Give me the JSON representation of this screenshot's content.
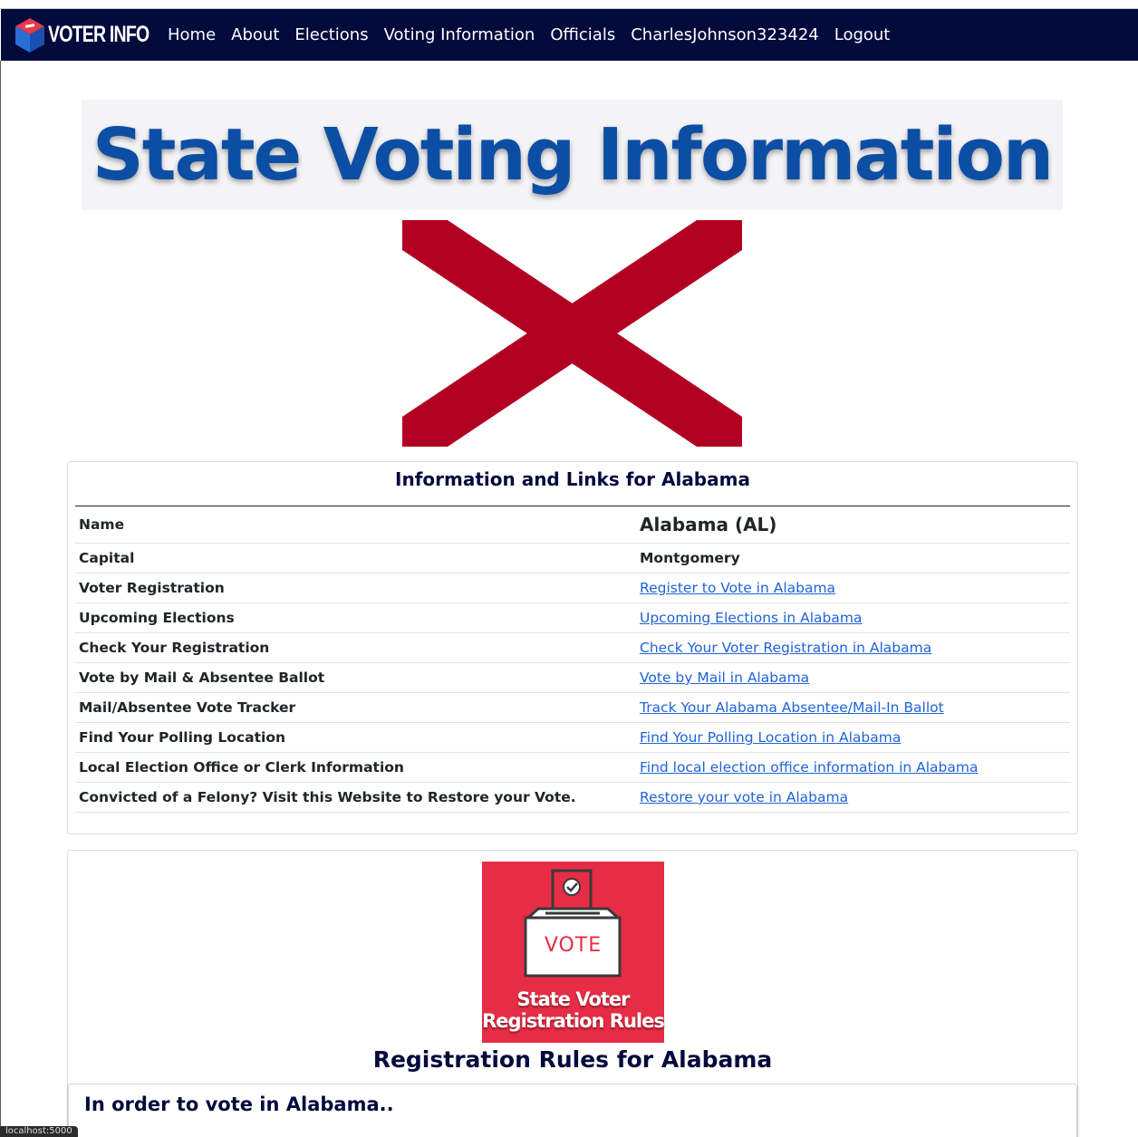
{
  "navbar": {
    "brand": "VOTER INFO",
    "links": [
      "Home",
      "About",
      "Elections",
      "Voting Information",
      "Officials",
      "CharlesJohnson323424",
      "Logout"
    ]
  },
  "banner": {
    "title": "State Voting Information"
  },
  "info_card": {
    "title": "Information and Links for Alabama",
    "rows": [
      {
        "label": "Name",
        "value": "Alabama (AL)"
      },
      {
        "label": "Capital",
        "value": "Montgomery"
      },
      {
        "label": "Voter Registration",
        "value": "Register to Vote in Alabama"
      },
      {
        "label": "Upcoming Elections",
        "value": "Upcoming Elections in Alabama"
      },
      {
        "label": "Check Your Registration",
        "value": "Check Your Voter Registration in Alabama"
      },
      {
        "label": "Vote by Mail & Absentee Ballot",
        "value": "Vote by Mail in Alabama"
      },
      {
        "label": "Mail/Absentee Vote Tracker",
        "value": "Track Your Alabama Absentee/Mail-In Ballot"
      },
      {
        "label": "Find Your Polling Location",
        "value": "Find Your Polling Location in Alabama"
      },
      {
        "label": "Local Election Office or Clerk Information",
        "value": "Find local election office information in Alabama"
      },
      {
        "label": "Convicted of a Felony? Visit this Website to Restore your Vote.",
        "value": "Restore your vote in Alabama"
      }
    ]
  },
  "rules_card": {
    "image": {
      "box_label": "VOTE",
      "caption_line1": "State Voter",
      "caption_line2": "Registration Rules"
    },
    "title": "Registration Rules for Alabama",
    "inner_title": "In order to vote in Alabama.."
  },
  "status_bar": "localhost:5000",
  "colors": {
    "navbar": "#030a3c",
    "banner_text": "#0d4ea5",
    "flag_cross": "#b10021",
    "link": "#1f63d6",
    "vote_bg": "#e72d45"
  }
}
